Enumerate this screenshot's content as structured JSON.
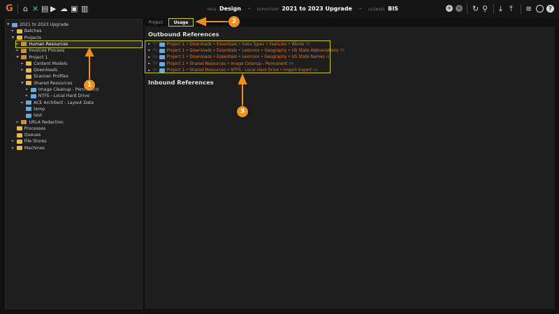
{
  "header": {
    "page_label": "PAGE",
    "page": "Design",
    "repository_label": "REPOSITORY",
    "repository": "2021 to 2023 Upgrade",
    "licensee_label": "LICENSEE",
    "licensee": "BIS",
    "logo": "G"
  },
  "toolbar_icons": [
    "home-icon",
    "tools-icon",
    "archive-icon",
    "video-icon",
    "cloud-upload-icon",
    "toolbox-icon",
    "chart-icon",
    "add-icon",
    "add-disabled-icon",
    "refresh-icon",
    "search-icon",
    "download-icon",
    "upload-icon",
    "database-icon",
    "user-icon",
    "help-icon"
  ],
  "tree": [
    {
      "label": "2021 to 2023 Upgrade",
      "depth": 0,
      "caret": "▼",
      "icon": "doc"
    },
    {
      "label": "Batches",
      "depth": 1,
      "caret": "►",
      "icon": "folder"
    },
    {
      "label": "Projects",
      "depth": 1,
      "caret": "▼",
      "icon": "folder"
    },
    {
      "label": "Human Resources",
      "depth": 2,
      "caret": "►",
      "icon": "proj",
      "selected": true
    },
    {
      "label": "Invoices Process",
      "depth": 2,
      "caret": "►",
      "icon": "proj"
    },
    {
      "label": "Project 1",
      "depth": 2,
      "caret": "▼",
      "icon": "proj"
    },
    {
      "label": "Content Models",
      "depth": 3,
      "caret": "►",
      "icon": "folder"
    },
    {
      "label": "Downloads",
      "depth": 3,
      "caret": "►",
      "icon": "folder"
    },
    {
      "label": "Scanner Profiles",
      "depth": 3,
      "caret": "",
      "icon": "folder"
    },
    {
      "label": "Shared Resources",
      "depth": 3,
      "caret": "▼",
      "icon": "folder"
    },
    {
      "label": "Image Cleanup - Permanent",
      "depth": 4,
      "caret": "►",
      "icon": "doc"
    },
    {
      "label": "NTFS - Local Hard Drive",
      "depth": 4,
      "caret": "►",
      "icon": "doc"
    },
    {
      "label": "ACE Architect - Layout Data",
      "depth": 3,
      "caret": "►",
      "icon": "doc"
    },
    {
      "label": "temp",
      "depth": 3,
      "caret": "",
      "icon": "doc"
    },
    {
      "label": "test",
      "depth": 3,
      "caret": "",
      "icon": "doc"
    },
    {
      "label": "URLA Redaction",
      "depth": 2,
      "caret": "►",
      "icon": "proj"
    },
    {
      "label": "Processes",
      "depth": 1,
      "caret": "",
      "icon": "folder"
    },
    {
      "label": "Queues",
      "depth": 1,
      "caret": "",
      "icon": "folder"
    },
    {
      "label": "File Stores",
      "depth": 1,
      "caret": "►",
      "icon": "folder"
    },
    {
      "label": "Machines",
      "depth": 1,
      "caret": "►",
      "icon": "folder"
    }
  ],
  "tabs": [
    {
      "label": "Project",
      "active": false
    },
    {
      "label": "Usage",
      "active": true
    }
  ],
  "outbound": {
    "title": "Outbound References",
    "to_label": "TO",
    "items": [
      {
        "path": "Project 1 • Downloads • Essentials • Data Types • Features • Words",
        "count": "(1)"
      },
      {
        "path": "Project 1 • Downloads • Essentials • Lexicons • Geography • US State Abbreviations",
        "count": "(1)"
      },
      {
        "path": "Project 1 • Downloads • Essentials • Lexicons • Geography • US State Names",
        "count": "(1)"
      },
      {
        "path": "Project 1 • Shared Resources • Image Cleanup - Permanent",
        "count": "(1)"
      },
      {
        "path": "Project 1 • Shared Resources • NTFS - Local Hard Drive • Import Export",
        "count": "(1)"
      }
    ]
  },
  "inbound": {
    "title": "Inbound References"
  },
  "annotations": [
    "1",
    "2",
    "3"
  ],
  "colors": {
    "accent": "#e8762c",
    "highlight": "#c8cc1e",
    "badge": "#f0901e"
  }
}
